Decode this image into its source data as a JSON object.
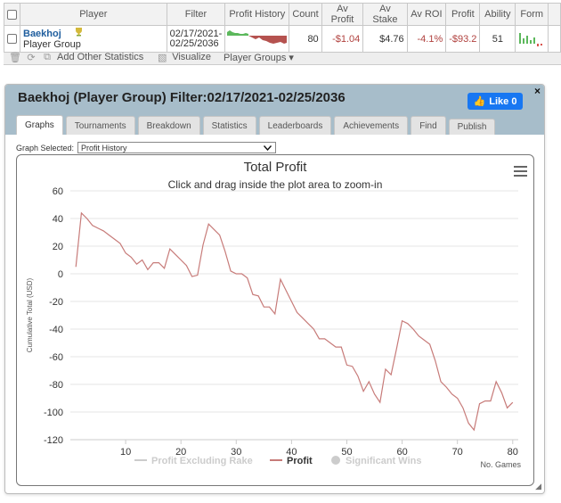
{
  "table": {
    "headers": [
      "Player",
      "Filter",
      "Profit History",
      "Count",
      "Av Profit",
      "Av Stake",
      "Av ROI",
      "Profit",
      "Ability",
      "Form"
    ],
    "row": {
      "player_name": "Baekhoj",
      "player_type": "Player Group",
      "filter_line1": "02/17/2021-",
      "filter_line2": "02/25/2036",
      "count": "80",
      "av_profit": "-$1.04",
      "av_stake": "$4.76",
      "av_roi": "-4.1%",
      "profit": "-$93.2",
      "ability": "51"
    }
  },
  "toolbar": {
    "add_stats": "Add Other Statistics",
    "visualize": "Visualize",
    "player_groups": "Player Groups"
  },
  "panel": {
    "title": "Baekhoj (Player Group) Filter:02/17/2021-02/25/2036",
    "like_label": "Like 0",
    "close": "×",
    "tabs": [
      "Graphs",
      "Tournaments",
      "Breakdown",
      "Statistics",
      "Leaderboards",
      "Achievements",
      "Find",
      "Publish"
    ],
    "graph_selected_label": "Graph Selected:",
    "graph_selected_value": "Profit History"
  },
  "colors": {
    "profit_line": "#c77b79",
    "header_bg": "#a7bdca",
    "like_blue": "#1877f2",
    "neg_text": "#b0413e",
    "sparkline_pos": "#5cb85c",
    "sparkline_neg": "#b0413e"
  },
  "chart_data": {
    "type": "line",
    "title": "Total Profit",
    "subtitle": "Click and drag inside the plot area to zoom-in",
    "xlabel": "No. Games",
    "ylabel": "Cumulative Total (USD)",
    "xlim": [
      0,
      81
    ],
    "ylim": [
      -120,
      60
    ],
    "xticks": [
      10,
      20,
      30,
      40,
      50,
      60,
      70,
      80
    ],
    "yticks": [
      60,
      40,
      20,
      0,
      -20,
      -40,
      -60,
      -80,
      -100,
      -120
    ],
    "legend": [
      "Profit Excluding Rake",
      "Profit",
      "Significant Wins"
    ],
    "series": [
      {
        "name": "Profit",
        "x": [
          1,
          2,
          3,
          4,
          5,
          6,
          7,
          8,
          9,
          10,
          11,
          12,
          13,
          14,
          15,
          16,
          17,
          18,
          19,
          20,
          21,
          22,
          23,
          24,
          25,
          26,
          27,
          28,
          29,
          30,
          31,
          32,
          33,
          34,
          35,
          36,
          37,
          38,
          39,
          40,
          41,
          42,
          43,
          44,
          45,
          46,
          47,
          48,
          49,
          50,
          51,
          52,
          53,
          54,
          55,
          56,
          57,
          58,
          59,
          60,
          61,
          62,
          63,
          64,
          65,
          66,
          67,
          68,
          69,
          70,
          71,
          72,
          73,
          74,
          75,
          76,
          77,
          78,
          79,
          80
        ],
        "values": [
          5,
          44,
          40,
          35,
          33,
          31,
          28,
          25,
          22,
          15,
          12,
          7,
          10,
          3,
          8,
          8,
          4,
          18,
          14,
          10,
          6,
          -2,
          -1,
          21,
          36,
          32,
          28,
          16,
          2,
          0,
          0,
          -3,
          -15,
          -16,
          -24,
          -24,
          -29,
          -4,
          -12,
          -20,
          -28,
          -32,
          -36,
          -40,
          -47,
          -47,
          -50,
          -53,
          -53,
          -66,
          -67,
          -74,
          -85,
          -78,
          -87,
          -93,
          -69,
          -73,
          -54,
          -34,
          -36,
          -40,
          -45,
          -48,
          -51,
          -63,
          -78,
          -82,
          -87,
          -90,
          -97,
          -108,
          -113,
          -94,
          -92,
          -92,
          -78,
          -86,
          -97,
          -93
        ]
      }
    ]
  }
}
